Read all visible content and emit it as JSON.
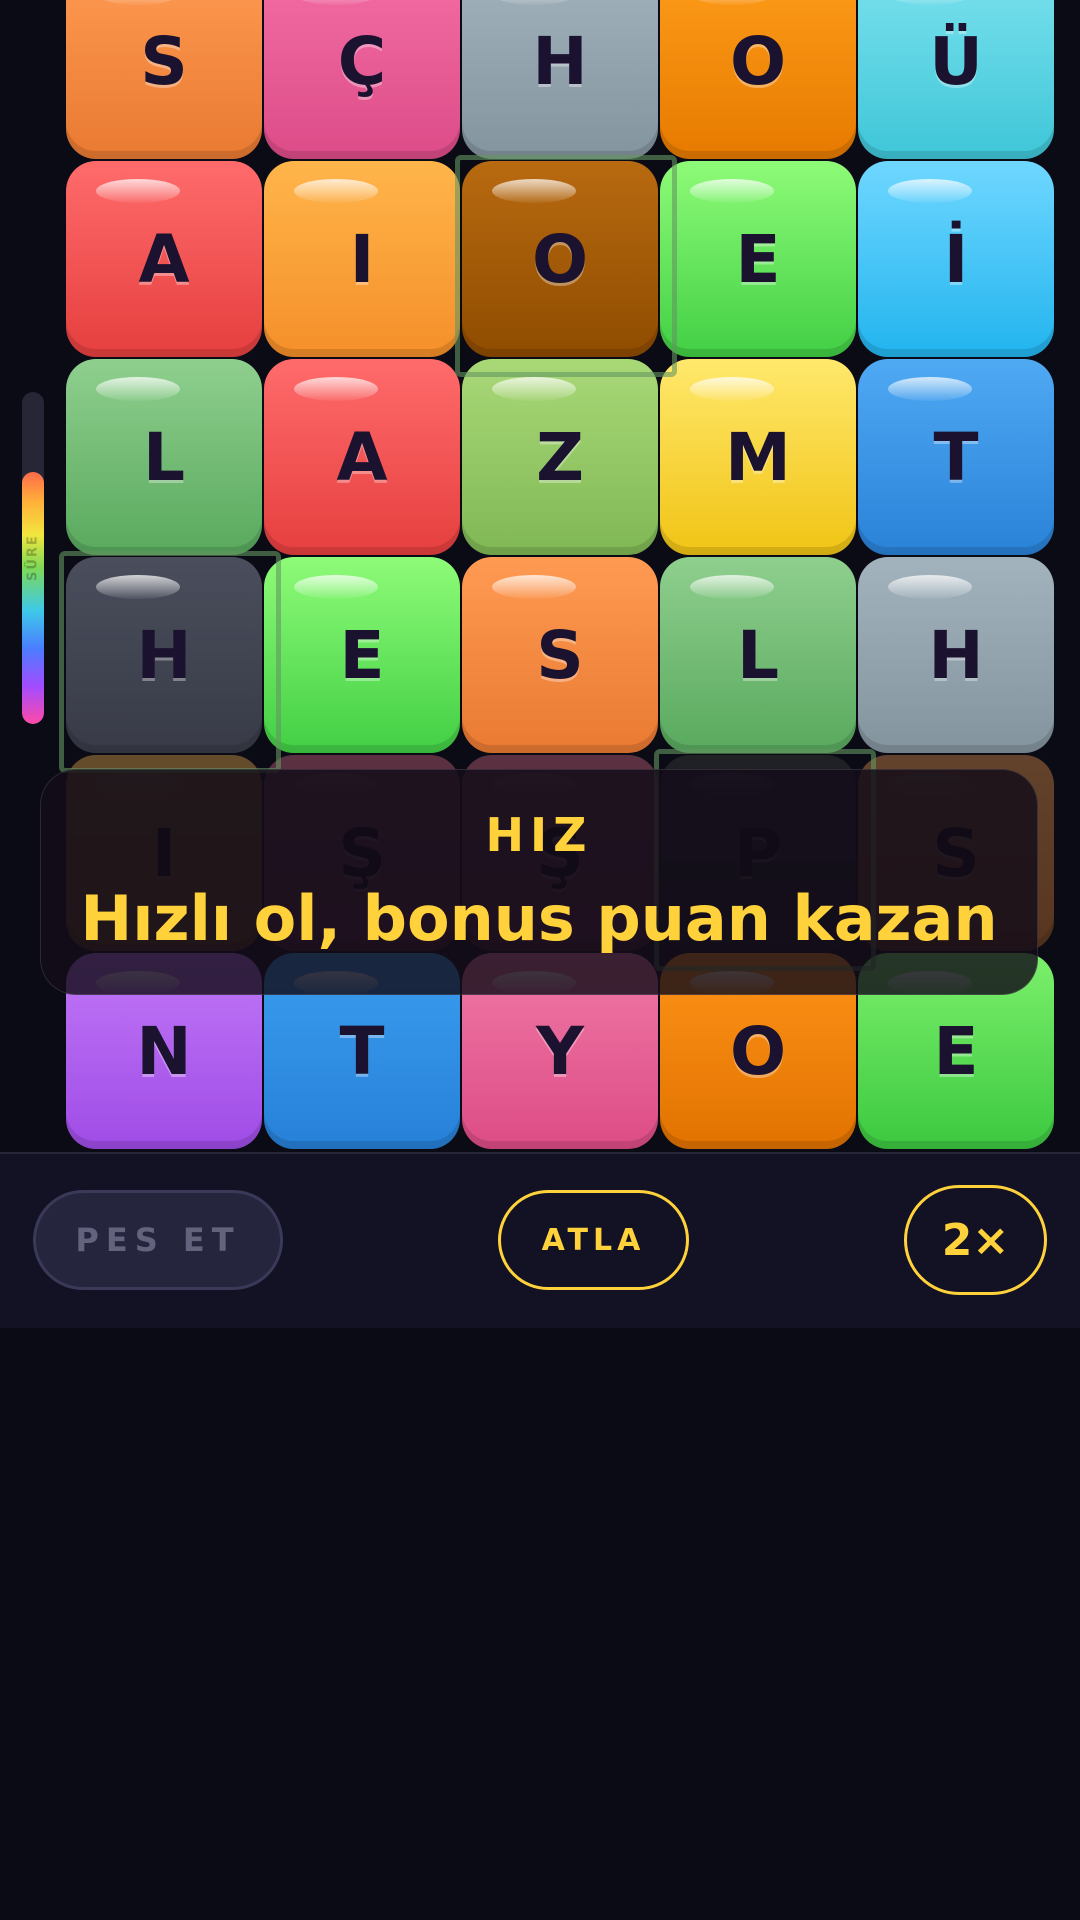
{
  "timer": {
    "label": "SÜRE",
    "fill_fraction": 0.76
  },
  "board": {
    "columns": 5,
    "tiles": [
      {
        "letter": "S",
        "color": "orange",
        "dimmed": false
      },
      {
        "letter": "Ç",
        "color": "pink",
        "dimmed": false
      },
      {
        "letter": "H",
        "color": "gray",
        "dimmed": false
      },
      {
        "letter": "O",
        "color": "amber",
        "dimmed": false
      },
      {
        "letter": "Ü",
        "color": "cyan",
        "dimmed": false
      },
      {
        "letter": "A",
        "color": "red",
        "dimmed": false
      },
      {
        "letter": "I",
        "color": "lorange",
        "dimmed": false
      },
      {
        "letter": "O",
        "color": "brown",
        "dimmed": false
      },
      {
        "letter": "E",
        "color": "green",
        "dimmed": false
      },
      {
        "letter": "İ",
        "color": "sky",
        "dimmed": false
      },
      {
        "letter": "L",
        "color": "sage",
        "dimmed": false
      },
      {
        "letter": "A",
        "color": "red",
        "dimmed": false
      },
      {
        "letter": "Z",
        "color": "olive",
        "dimmed": false
      },
      {
        "letter": "M",
        "color": "yellow",
        "dimmed": false
      },
      {
        "letter": "T",
        "color": "blue",
        "dimmed": false
      },
      {
        "letter": "H",
        "color": "slate",
        "dimmed": false
      },
      {
        "letter": "E",
        "color": "green",
        "dimmed": false
      },
      {
        "letter": "S",
        "color": "orange",
        "dimmed": false
      },
      {
        "letter": "L",
        "color": "sage",
        "dimmed": false
      },
      {
        "letter": "H",
        "color": "gray",
        "dimmed": false
      },
      {
        "letter": "I",
        "color": "lorange",
        "dimmed": true
      },
      {
        "letter": "Ş",
        "color": "pink",
        "dimmed": true
      },
      {
        "letter": "Ş",
        "color": "pink",
        "dimmed": true
      },
      {
        "letter": "P",
        "color": "slate",
        "dimmed": true
      },
      {
        "letter": "S",
        "color": "orange",
        "dimmed": true
      },
      {
        "letter": "N",
        "color": "purple",
        "dimmed": false
      },
      {
        "letter": "T",
        "color": "blue2",
        "dimmed": false
      },
      {
        "letter": "Y",
        "color": "pink2",
        "dimmed": false
      },
      {
        "letter": "O",
        "color": "amber2",
        "dimmed": false
      },
      {
        "letter": "E",
        "color": "green2",
        "dimmed": false
      }
    ]
  },
  "hint": {
    "title": "HIZ",
    "text": "Hızlı ol, bonus puan kazan"
  },
  "controls": {
    "give_up_label": "PES ET",
    "skip_label": "ATLA",
    "multiplier_label": "2×"
  },
  "colors": {
    "accent_yellow": "#ffd13b",
    "background": "#0b0b16",
    "bottom_bar": "#121224",
    "tile_text": "#1b1230",
    "selection_frame": "#629660"
  }
}
